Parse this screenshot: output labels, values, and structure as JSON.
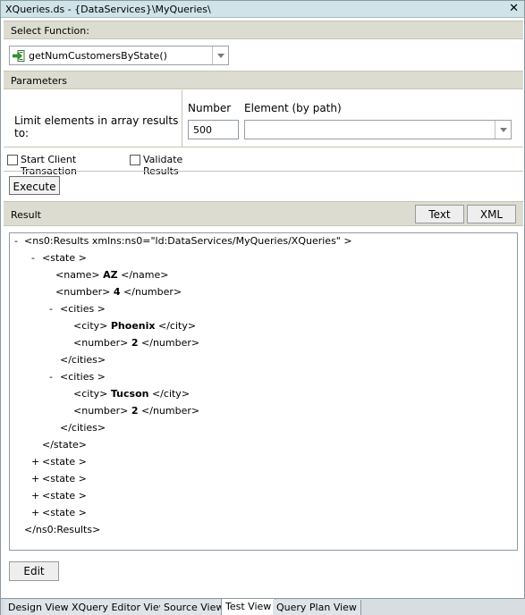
{
  "window": {
    "title": "XQueries.ds - {DataServices}\\MyQueries\\",
    "close_glyph": "✕"
  },
  "select_function": {
    "header": "Select Function:",
    "selected": "getNumCustomersByState()",
    "icon": "function-arrow-icon"
  },
  "parameters": {
    "header": "Parameters",
    "limit_label": "Limit elements in array results to:",
    "number_label": "Number",
    "number_value": "500",
    "element_label": "Element (by path)",
    "element_value": ""
  },
  "options": {
    "start_client_transaction": {
      "label": "Start Client Transaction",
      "checked": false
    },
    "validate_results": {
      "label": "Validate Results",
      "checked": false
    }
  },
  "execute_button": "Execute",
  "result": {
    "header": "Result",
    "text_button": "Text",
    "xml_button": "XML",
    "tree": [
      {
        "toggle": "-",
        "text": "<ns0:Results xmlns:ns0=\"ld:DataServices/MyQueries/XQueries\" >"
      },
      {
        "toggle": "-",
        "text": "<state >"
      },
      {
        "open": "<name>",
        "value": "AZ",
        "close": "</name>"
      },
      {
        "open": "<number>",
        "value": "4",
        "close": "</number>"
      },
      {
        "toggle": "-",
        "text": "<cities >"
      },
      {
        "open": "<city>",
        "value": "Phoenix",
        "close": "</city>"
      },
      {
        "open": "<number>",
        "value": "2",
        "close": "</number>"
      },
      {
        "text": "</cities>"
      },
      {
        "toggle": "-",
        "text": "<cities >"
      },
      {
        "open": "<city>",
        "value": "Tucson",
        "close": "</city>"
      },
      {
        "open": "<number>",
        "value": "2",
        "close": "</number>"
      },
      {
        "text": "</cities>"
      },
      {
        "text": "</state>"
      },
      {
        "toggle": "+",
        "text": "<state >"
      },
      {
        "toggle": "+",
        "text": "<state >"
      },
      {
        "toggle": "+",
        "text": "<state >"
      },
      {
        "toggle": "+",
        "text": "<state >"
      },
      {
        "text": "</ns0:Results>"
      }
    ]
  },
  "edit_button": "Edit",
  "tabs": [
    {
      "label": "Design View",
      "active": false
    },
    {
      "label": "XQuery Editor View",
      "active": false
    },
    {
      "label": "Source View",
      "active": false
    },
    {
      "label": "Test View",
      "active": true
    },
    {
      "label": "Query Plan View",
      "active": false
    }
  ]
}
